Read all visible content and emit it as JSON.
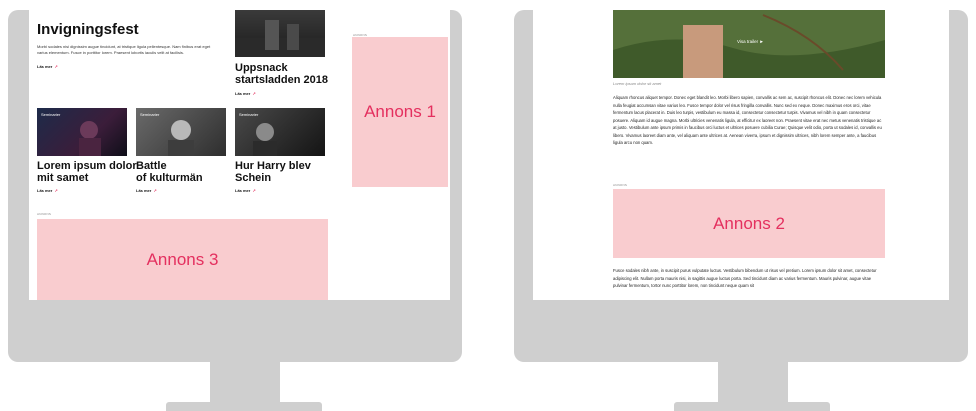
{
  "left": {
    "top_article": {
      "title": "Invigningsfest",
      "excerpt": "Morbi sodales nisi dignissim augue tincidunt, at tristique ligula pellentesque. Nam finibus erat eget varius elementum. Fusce in porttitor lorem. Praesent lobortis iaculis velit at facilisis.",
      "read_more": "Läs mer"
    },
    "side_article": {
      "title_line1": "Uppsnack",
      "title_line2": "startsladden 2018",
      "read_more": "Läs mer"
    },
    "cards": [
      {
        "category": "Seminarier",
        "title_line1": "Lorem ipsum dolor",
        "title_line2": "mit samet",
        "read_more": "Läs mer"
      },
      {
        "category": "Seminarier",
        "title_line1": "Battle",
        "title_line2": "of kulturmän",
        "read_more": "Läs mer"
      },
      {
        "category": "Seminarier",
        "title_line1": "Hur Harry blev",
        "title_line2": "Schein",
        "read_more": "Läs mer"
      }
    ],
    "ad1": {
      "tag": "ANNONS",
      "label": "Annons 1"
    },
    "ad3": {
      "tag": "ANNONS",
      "label": "Annons 3"
    }
  },
  "right": {
    "video": {
      "trailer_label": "Visa trailer ►"
    },
    "caption": "Lorem ipsum dolor sit amet",
    "para1": "Aliquam rhoncus aliquet tempor. Donec eget blandit leo. Morbi libero sapien, convallis ac sem ac, suscipit rhoncus elit. Donec nec lorem vehicula nulla feugiat accumsan vitae varius leo. Fusce tempor dolor vel risus fringilla convallis. Nunc sed ex neque. Donec maximus eros orci, vitae fermentum lacus placerat in. Duis leo turpis, vestibulum eu massa id, consectetur consectetur turpis. Vivamus vel nibh in quam consectetur posuere. Aliquam id augue magna. Morbi ultricies venenatis ligula, at efficitur ex laoreet non. Praesent vitae erat nec metus venenatis tristique ac at justo. Vestibulum ante ipsum primis in faucibus orci luctus et ultrices posuere cubilia Curae; Quisque velit odio, porta ut sodales id, convallis eu libero. Vivamus laoreet diam ante, vel aliquam ante ultrices at. Aenean viverra, ipsum et dignissim ultrices, nibh lorem semper ante, a faucibus ligula arcu non quam.",
    "ad2": {
      "tag": "ANNONS",
      "label": "Annons 2"
    },
    "para2": "Fusce sodales nibh ante, in suscipit purus vulputate luctus. Vestibulum bibendum ut risus vel pretium. Lorem ipsum dolor sit amet, consectetur adipiscing elit. Nullam porta mauris nisi, in sagittis augue luctus porta. Sed tincidunt diam ac varius fermentum. Mauris pulvinar, augue vitae pulvinar fermentum, tortor nunc porttitor lorem, non tincidunt neque quam sit"
  },
  "colors": {
    "accent": "#e4305f",
    "ad_bg": "#f9cccf",
    "bezel": "#cfcfcf"
  }
}
